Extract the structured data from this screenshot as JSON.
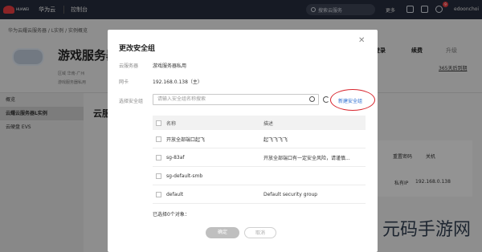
{
  "topbar": {
    "logo_text": "HUAWEI",
    "brand": "华为云",
    "console": "控制台",
    "search_placeholder": "搜索云服务",
    "more": "更多",
    "notification_count": "9",
    "user": "edoonchoi"
  },
  "page": {
    "breadcrumb": "华为云耀云服务器 / L实例 / 实例概览",
    "server_title": "游戏服务器",
    "meta_region": "区域 华南-广州",
    "meta_name": "游戏服务器私用",
    "actions": {
      "login": "登录",
      "renew": "续费",
      "upgrade": "升级"
    },
    "expire": "365天后到期",
    "section_title": "云服",
    "sidebar": [
      "概览",
      "云耀云服务器L实例",
      "云硬盘 EVS"
    ],
    "bg_actions": {
      "reset_pwd": "重置密码",
      "shutdown": "关机",
      "private_ip_label": "私有IP",
      "private_ip": "192.168.0.138"
    }
  },
  "modal": {
    "title": "更改安全组",
    "server_label": "云服务器",
    "server_value": "游戏服务器私用",
    "nic_label": "网卡",
    "nic_value": "192.168.0.138（主）",
    "sg_label": "选择安全组",
    "search_placeholder": "请输入安全组名称搜索",
    "new_sg": "新建安全组",
    "columns": {
      "name": "名称",
      "desc": "描述"
    },
    "rows": [
      {
        "name": "开放全部端口起飞",
        "desc": "起飞飞飞飞"
      },
      {
        "name": "sg-83af",
        "desc": "开放全部端口有一定安全风险，请谨慎..."
      },
      {
        "name": "sg-default-smb",
        "desc": ""
      },
      {
        "name": "default",
        "desc": "Default security group"
      }
    ],
    "selected_text": "已选择0个对象：",
    "ok": "确定",
    "cancel": "取消"
  },
  "watermark": "元码手游网"
}
